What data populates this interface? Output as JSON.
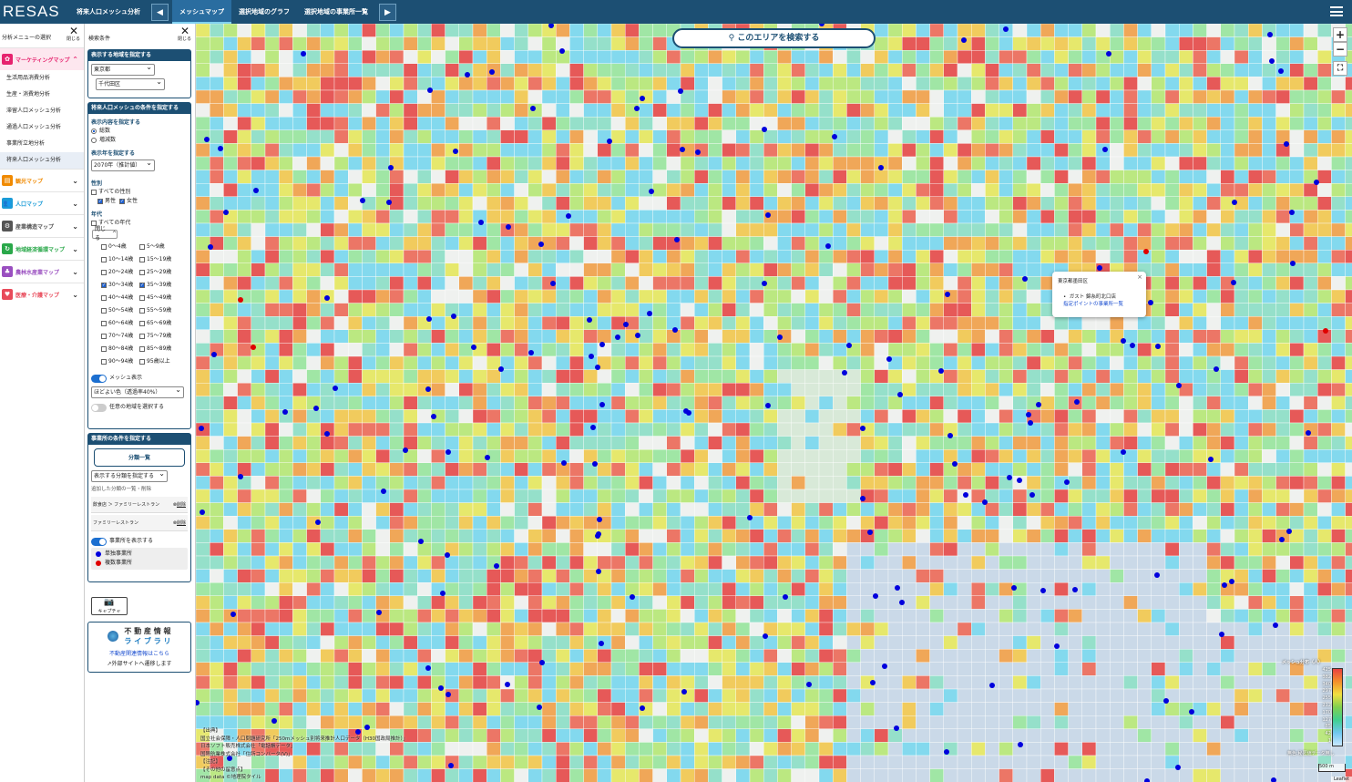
{
  "topbar": {
    "logo": "RESAS",
    "tabs": [
      "将来人口メッシュ分析",
      "メッシュマップ",
      "選択地域のグラフ",
      "選択地域の事業所一覧"
    ]
  },
  "leftmenu": {
    "title": "分析メニューの選択",
    "close": "閉じる",
    "categories": [
      {
        "label": "マーケティングマップ",
        "color": "#e6236e",
        "icon": "shop-icon"
      },
      {
        "label": "観光マップ",
        "color": "#f08a00",
        "icon": "map-icon"
      },
      {
        "label": "人口マップ",
        "color": "#1a9bd7",
        "icon": "people-icon"
      },
      {
        "label": "産業構造マップ",
        "color": "#555555",
        "icon": "gears-icon"
      },
      {
        "label": "地域経済循環マップ",
        "color": "#2aa84a",
        "icon": "cycle-icon"
      },
      {
        "label": "農林水産業マップ",
        "color": "#9a4fc0",
        "icon": "tree-icon"
      },
      {
        "label": "医療・介護マップ",
        "color": "#e84a5a",
        "icon": "heart-icon"
      }
    ],
    "subitems": [
      "生活用品消費分析",
      "生産・消費地分析",
      "滞留人口メッシュ分析",
      "通過人口メッシュ分析",
      "事業所立地分析",
      "将来人口メッシュ分析"
    ]
  },
  "search": {
    "title": "検索条件",
    "close": "閉じる",
    "region_title": "表示する地域を指定する",
    "prefecture": "東京都",
    "city": "千代田区",
    "mesh_title": "将来人口メッシュの条件を指定する",
    "content_label": "表示内容を指定する",
    "content_opts": [
      "総数",
      "増減数"
    ],
    "year_label": "表示年を指定する",
    "year": "2070年（推計値）",
    "sex_label": "性別",
    "sex_all": "すべての性別",
    "sex_opts": [
      "男性",
      "女性"
    ],
    "age_label": "年代",
    "age_all": "すべての年代",
    "collapse": "閉じる",
    "ages": [
      "0～4歳",
      "5～9歳",
      "10～14歳",
      "15～19歳",
      "20～24歳",
      "25～29歳",
      "30～34歳",
      "35～39歳",
      "40～44歳",
      "45～49歳",
      "50～54歳",
      "55～59歳",
      "60～64歳",
      "65～69歳",
      "70～74歳",
      "75～79歳",
      "80～84歳",
      "85～89歳",
      "90～94歳",
      "95歳以上"
    ],
    "mesh_show": "メッシュ表示",
    "opacity": "ほどよい色（透過率40%）",
    "any_region": "任意の地域を選択する",
    "office_title": "事業所の条件を指定する",
    "category_btn": "分類一覧",
    "category_select": "表示する分類を指定する",
    "added_label": "追加した分類の一覧・削除",
    "chips": [
      "飲食店 ＞ ファミリーレストラン",
      "ファミリーレストラン"
    ],
    "delete": "削除",
    "office_show": "事業所を表示する",
    "legend": [
      "単独事業所",
      "複数事業所"
    ],
    "capture": "キャプチャ",
    "realestate_title1": "不 動 産 情 報",
    "realestate_title2": "ラ イ ブ ラ リ",
    "realestate_link": "不動産関連情報はこちら",
    "external": "外部サイトへ遷移します"
  },
  "map": {
    "search_button": "このエリアを検索する",
    "zoom_in": "+",
    "zoom_out": "−",
    "popup_title": "東京都墨田区",
    "popup_item": "ガスト 錦糸町北口店",
    "popup_link": "指定ポイントの事業所一覧",
    "legend_title": "メッシュ分布（人）",
    "legend_values": [
      "425",
      "382",
      "340",
      "297",
      "255",
      "212",
      "170",
      "127",
      "85",
      "42",
      "1"
    ],
    "legend_note": "無色:秘匿値データ無し",
    "scale": "500 m",
    "leaflet": "Leaflet",
    "attribution": [
      "【出典】",
      "国立社会保障・人口問題研究所「250mメッシュ別将来推計人口データ（H30国政局推計）」",
      "日本ソフト販売株式会社「電話帳データ」",
      "国際航業株式会社「住所コンバータ(V)」",
      "【注記】",
      "【その他の留意点】",
      "map data ©地理院タイル"
    ]
  }
}
